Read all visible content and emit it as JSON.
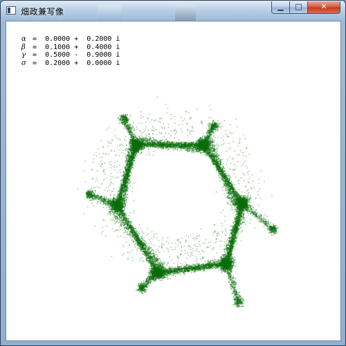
{
  "window": {
    "title": "畑政兼写像",
    "controls": {
      "minimize": "▁",
      "maximize": "□",
      "close": "✕"
    }
  },
  "params": [
    {
      "symbol": "α",
      "text": " =  0.0000 +  0.2000 i"
    },
    {
      "symbol": "β",
      "text": " =  0.1000 +  0.4000 i"
    },
    {
      "symbol": "γ",
      "text": " =  0.5000 -  0.9000 i"
    },
    {
      "symbol": "σ",
      "text": " =  0.2000 +  0.0000 i"
    }
  ],
  "fractal": {
    "color": "#0b6e0b"
  }
}
